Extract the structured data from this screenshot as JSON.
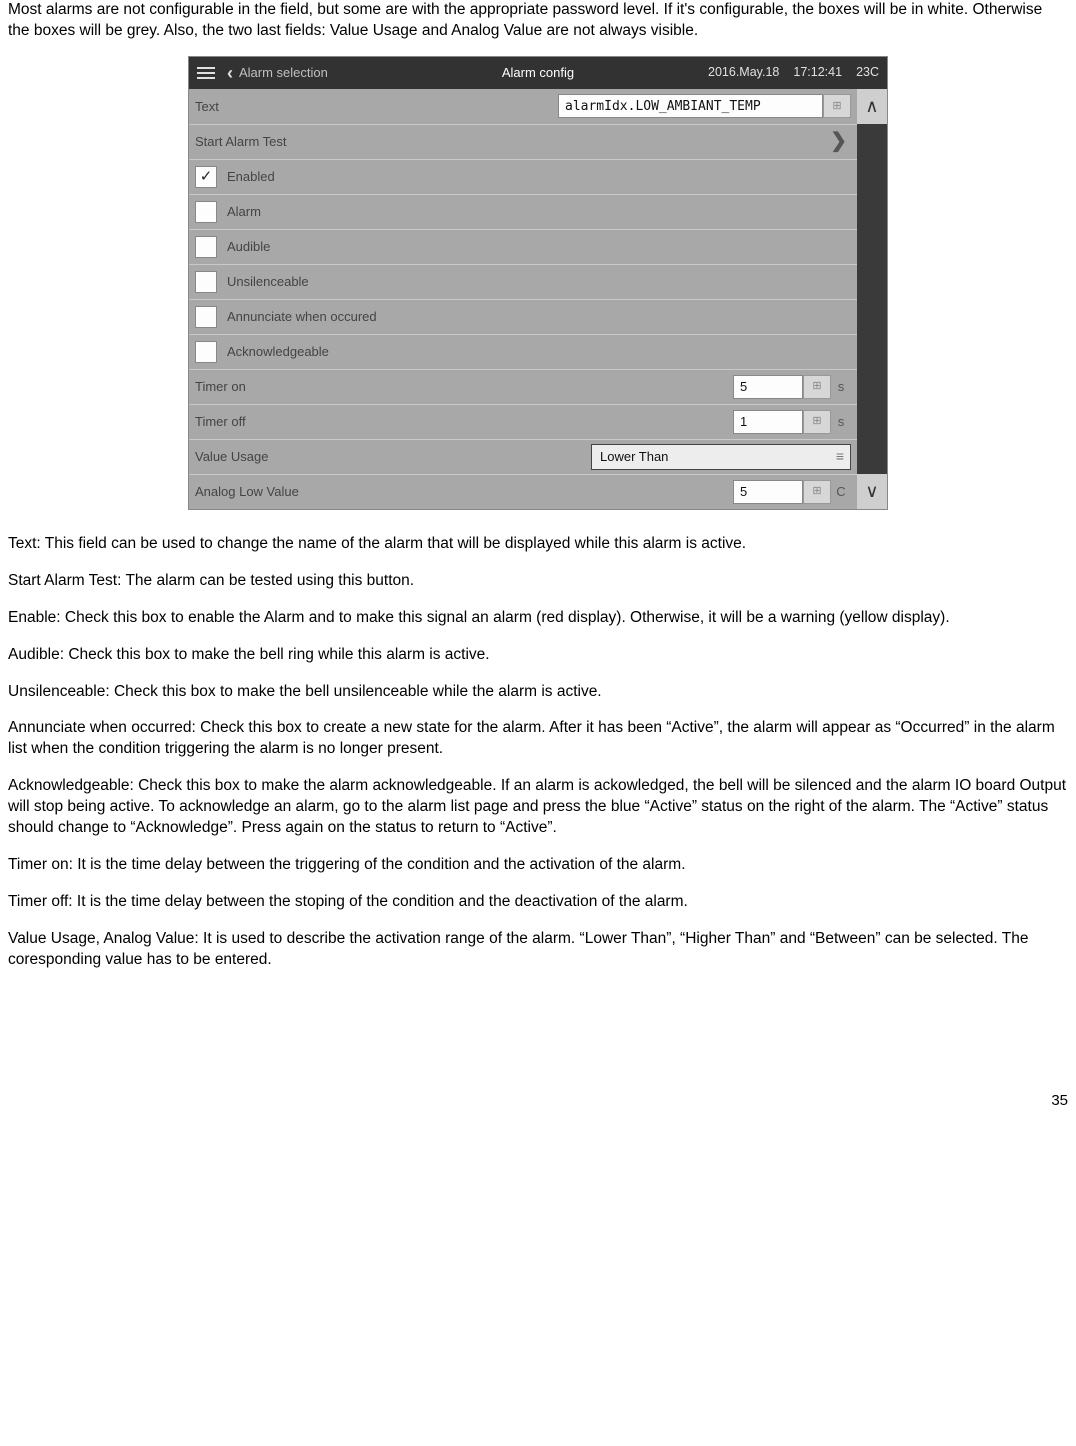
{
  "intro": "Most alarms are not configurable in the field, but some are with the appropriate password level. If it's configurable, the boxes will be in white. Otherwise the boxes will be grey. Also, the two last fields: Value Usage and Analog Value are not always visible.",
  "screen": {
    "header": {
      "breadcrumb": "Alarm selection",
      "title": "Alarm config",
      "date": "2016.May.18",
      "time": "17:12:41",
      "temp": "23C"
    },
    "rows": {
      "text_label": "Text",
      "text_value": "alarmIdx.LOW_AMBIANT_TEMP",
      "start_alarm_test": "Start Alarm Test",
      "enabled": "Enabled",
      "enabled_checked": "✓",
      "alarm": "Alarm",
      "audible": "Audible",
      "unsilenceable": "Unsilenceable",
      "annunciate": "Annunciate when occured",
      "acknowledgeable": "Acknowledgeable",
      "timer_on_label": "Timer on",
      "timer_on_value": "5",
      "timer_on_unit": "s",
      "timer_off_label": "Timer off",
      "timer_off_value": "1",
      "timer_off_unit": "s",
      "value_usage_label": "Value Usage",
      "value_usage_value": "Lower Than",
      "analog_low_label": "Analog Low Value",
      "analog_low_value": "5",
      "analog_low_unit": "C"
    }
  },
  "desc": {
    "p1": "Text: This field can be used to change the name of the alarm that will be displayed while this alarm is active.",
    "p2": "Start Alarm Test: The alarm can be tested using this button.",
    "p3": "Enable: Check this box to enable the Alarm and to make this signal an alarm (red display). Otherwise, it will be a warning (yellow display).",
    "p4": "Audible: Check this box to make the bell ring while this alarm is active.",
    "p5": "Unsilenceable: Check this box to make the bell unsilenceable while the alarm is active.",
    "p6": "Annunciate when occurred: Check this box to create a new state for the alarm. After it has been “Active”, the alarm will appear as “Occurred” in the alarm list when the condition triggering the alarm is no longer present.",
    "p7": "Acknowledgeable: Check this box to make the alarm acknowledgeable. If an alarm is ackowledged, the bell will be silenced and the alarm IO board Output will stop being active. To acknowledge an alarm, go to the alarm list page and press the blue “Active” status on the right of the alarm. The “Active” status should change to “Acknowledge”. Press again on the status to return to “Active”.",
    "p8": "Timer on: It is the time delay between the triggering of the condition and the activation of the alarm.",
    "p9": "Timer off: It is the time delay between the stoping of the condition and the deactivation of the alarm.",
    "p10": "Value Usage, Analog Value: It is used to describe the activation range of the alarm. “Lower Than”, “Higher Than” and “Between” can be selected. The coresponding value has to be entered."
  },
  "page_number": "35"
}
